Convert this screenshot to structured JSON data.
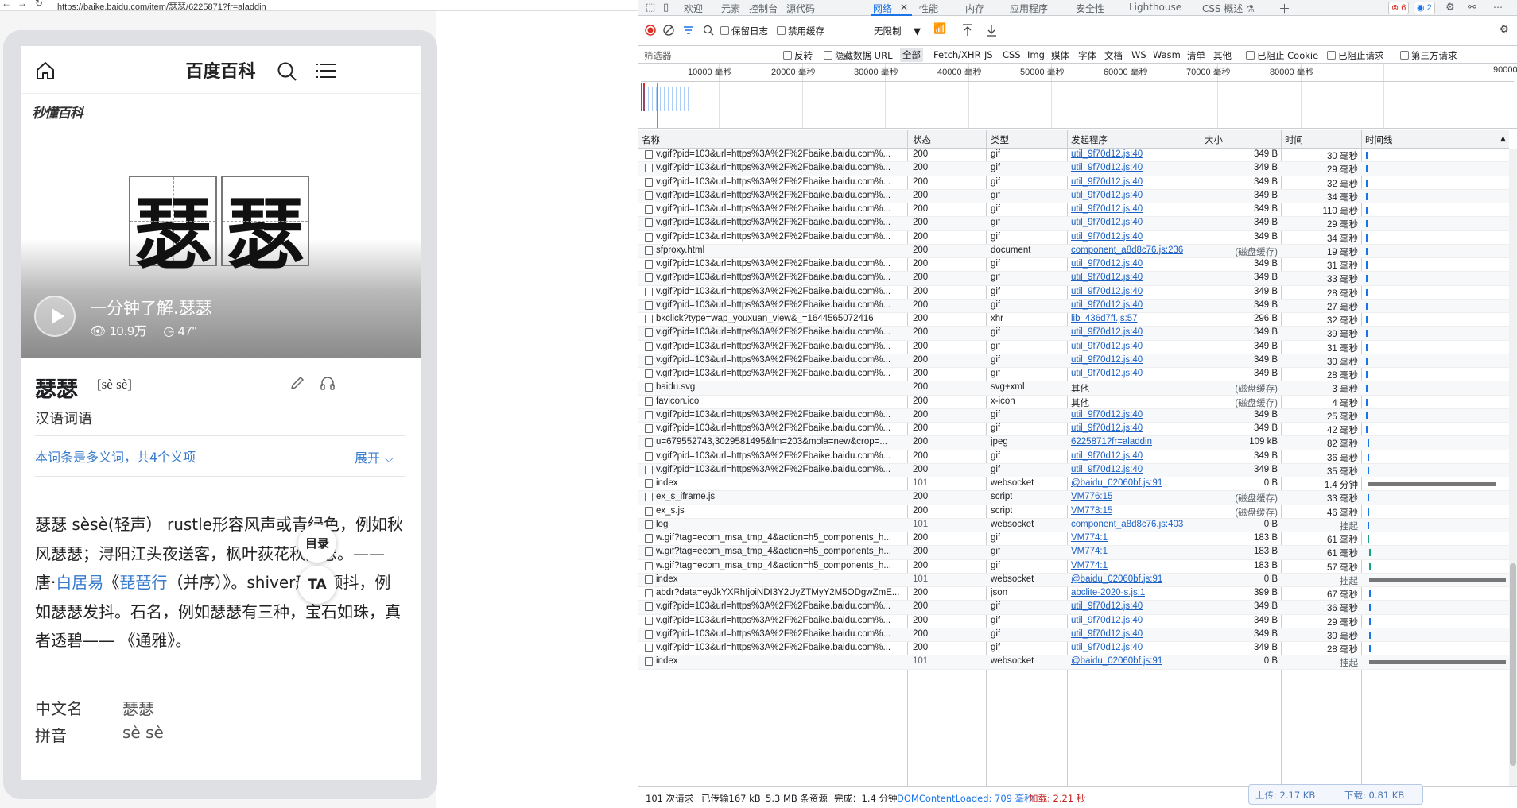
{
  "browser": {
    "url": "https://baike.baidu.com/item/瑟瑟/6225871?fr=aladdin"
  },
  "mobile": {
    "header_title": "百度百科",
    "logo_text": "秒懂百科",
    "characters": [
      "瑟",
      "瑟"
    ],
    "video_title": "一分钟了解.瑟瑟",
    "views": "10.9万",
    "duration": "47\"",
    "word": "瑟瑟",
    "pinyin": "[sè sè]",
    "entry_type": "汉语词语",
    "polysemy": "本词条是多义词，共4个义项",
    "expand": "展开",
    "desc_1": "瑟瑟 sèsè(轻声） rustle形容风声或青绿色，例如秋风瑟瑟；浔阳江头夜送客，枫叶荻花秋瑟瑟。—— 唐·",
    "desc_link1": "白居易",
    "desc_2": "《",
    "desc_link2": "琵琶行",
    "desc_3": "（并序）》。shiver形容颤抖，例如瑟瑟发抖。石名，例如瑟瑟有三种，宝石如珠，真者透碧—— 《通雅》。",
    "toc_button": "目录",
    "ta_button": "TA",
    "info_rows": [
      {
        "label": "中文名",
        "value": "瑟瑟"
      },
      {
        "label": "拼音",
        "value": "sè sè"
      }
    ]
  },
  "devtools": {
    "tabs": [
      "欢迎",
      "元素",
      "控制台",
      "源代码",
      "网络",
      "性能",
      "内存",
      "应用程序",
      "安全性",
      "Lighthouse",
      "CSS 概述 ⚗"
    ],
    "active_tab": "网络",
    "errors": "6",
    "messages": "2",
    "toolbar": {
      "preserve_log": "保留日志",
      "disable_cache": "禁用缓存",
      "throttle": "无限制"
    },
    "filter": {
      "placeholder": "筛选器",
      "invert": "反转",
      "hide_data_url": "隐藏数据 URL",
      "types": [
        "全部",
        "Fetch/XHR",
        "JS",
        "CSS",
        "Img",
        "媒体",
        "字体",
        "文档",
        "WS",
        "Wasm",
        "清单",
        "其他"
      ],
      "blocked_cookies": "已阻止 Cookie",
      "blocked_requests": "已阻止请求",
      "third_party": "第三方请求"
    },
    "overview_ticks": [
      "10000 毫秒",
      "20000 毫秒",
      "30000 毫秒",
      "40000 毫秒",
      "50000 毫秒",
      "60000 毫秒",
      "70000 毫秒",
      "80000 毫秒",
      "90000"
    ],
    "columns": [
      "名称",
      "状态",
      "类型",
      "发起程序",
      "大小",
      "时间",
      "时间线"
    ],
    "requests": [
      [
        "v.gif?pid=103&url=https%3A%2F%2Fbaike.baidu.com%...",
        "200",
        "gif",
        "util_9f70d12.js:40",
        "349 B",
        "30 毫秒"
      ],
      [
        "v.gif?pid=103&url=https%3A%2F%2Fbaike.baidu.com%...",
        "200",
        "gif",
        "util_9f70d12.js:40",
        "349 B",
        "29 毫秒"
      ],
      [
        "v.gif?pid=103&url=https%3A%2F%2Fbaike.baidu.com%...",
        "200",
        "gif",
        "util_9f70d12.js:40",
        "349 B",
        "32 毫秒"
      ],
      [
        "v.gif?pid=103&url=https%3A%2F%2Fbaike.baidu.com%...",
        "200",
        "gif",
        "util_9f70d12.js:40",
        "349 B",
        "34 毫秒"
      ],
      [
        "v.gif?pid=103&url=https%3A%2F%2Fbaike.baidu.com%...",
        "200",
        "gif",
        "util_9f70d12.js:40",
        "349 B",
        "110 毫秒"
      ],
      [
        "v.gif?pid=103&url=https%3A%2F%2Fbaike.baidu.com%...",
        "200",
        "gif",
        "util_9f70d12.js:40",
        "349 B",
        "29 毫秒"
      ],
      [
        "v.gif?pid=103&url=https%3A%2F%2Fbaike.baidu.com%...",
        "200",
        "gif",
        "util_9f70d12.js:40",
        "349 B",
        "34 毫秒"
      ],
      [
        "sfproxy.html",
        "200",
        "document",
        "component_a8d8c76.js:236",
        "(磁盘缓存)",
        "19 毫秒"
      ],
      [
        "v.gif?pid=103&url=https%3A%2F%2Fbaike.baidu.com%...",
        "200",
        "gif",
        "util_9f70d12.js:40",
        "349 B",
        "31 毫秒"
      ],
      [
        "v.gif?pid=103&url=https%3A%2F%2Fbaike.baidu.com%...",
        "200",
        "gif",
        "util_9f70d12.js:40",
        "349 B",
        "33 毫秒"
      ],
      [
        "v.gif?pid=103&url=https%3A%2F%2Fbaike.baidu.com%...",
        "200",
        "gif",
        "util_9f70d12.js:40",
        "349 B",
        "28 毫秒"
      ],
      [
        "v.gif?pid=103&url=https%3A%2F%2Fbaike.baidu.com%...",
        "200",
        "gif",
        "util_9f70d12.js:40",
        "349 B",
        "27 毫秒"
      ],
      [
        "bkclick?type=wap_youxuan_view&_=1644565072416",
        "200",
        "xhr",
        "lib_436d7ff.js:57",
        "296 B",
        "32 毫秒"
      ],
      [
        "v.gif?pid=103&url=https%3A%2F%2Fbaike.baidu.com%...",
        "200",
        "gif",
        "util_9f70d12.js:40",
        "349 B",
        "39 毫秒"
      ],
      [
        "v.gif?pid=103&url=https%3A%2F%2Fbaike.baidu.com%...",
        "200",
        "gif",
        "util_9f70d12.js:40",
        "349 B",
        "31 毫秒"
      ],
      [
        "v.gif?pid=103&url=https%3A%2F%2Fbaike.baidu.com%...",
        "200",
        "gif",
        "util_9f70d12.js:40",
        "349 B",
        "30 毫秒"
      ],
      [
        "v.gif?pid=103&url=https%3A%2F%2Fbaike.baidu.com%...",
        "200",
        "gif",
        "util_9f70d12.js:40",
        "349 B",
        "28 毫秒"
      ],
      [
        "baidu.svg",
        "200",
        "svg+xml",
        "其他",
        "(磁盘缓存)",
        "3 毫秒"
      ],
      [
        "favicon.ico",
        "200",
        "x-icon",
        "其他",
        "(磁盘缓存)",
        "4 毫秒"
      ],
      [
        "v.gif?pid=103&url=https%3A%2F%2Fbaike.baidu.com%...",
        "200",
        "gif",
        "util_9f70d12.js:40",
        "349 B",
        "25 毫秒"
      ],
      [
        "v.gif?pid=103&url=https%3A%2F%2Fbaike.baidu.com%...",
        "200",
        "gif",
        "util_9f70d12.js:40",
        "349 B",
        "42 毫秒"
      ],
      [
        "u=679552743,3029581495&fm=203&mola=new&crop=...",
        "200",
        "jpeg",
        "6225871?fr=aladdin",
        "109 kB",
        "82 毫秒"
      ],
      [
        "v.gif?pid=103&url=https%3A%2F%2Fbaike.baidu.com%...",
        "200",
        "gif",
        "util_9f70d12.js:40",
        "349 B",
        "36 毫秒"
      ],
      [
        "v.gif?pid=103&url=https%3A%2F%2Fbaike.baidu.com%...",
        "200",
        "gif",
        "util_9f70d12.js:40",
        "349 B",
        "35 毫秒"
      ],
      [
        "index",
        "101",
        "websocket",
        "@baidu_02060bf.js:91",
        "0 B",
        "1.4 分钟"
      ],
      [
        "ex_s_iframe.js",
        "200",
        "script",
        "VM776:15",
        "(磁盘缓存)",
        "33 毫秒"
      ],
      [
        "ex_s.js",
        "200",
        "script",
        "VM778:15",
        "(磁盘缓存)",
        "46 毫秒"
      ],
      [
        "log",
        "101",
        "websocket",
        "component_a8d8c76.js:403",
        "0 B",
        "挂起"
      ],
      [
        "w.gif?tag=ecom_msa_tmp_4&action=h5_components_h...",
        "200",
        "gif",
        "VM774:1",
        "183 B",
        "61 毫秒"
      ],
      [
        "w.gif?tag=ecom_msa_tmp_4&action=h5_components_h...",
        "200",
        "gif",
        "VM774:1",
        "183 B",
        "61 毫秒"
      ],
      [
        "w.gif?tag=ecom_msa_tmp_4&action=h5_components_h...",
        "200",
        "gif",
        "VM774:1",
        "183 B",
        "57 毫秒"
      ],
      [
        "index",
        "101",
        "websocket",
        "@baidu_02060bf.js:91",
        "0 B",
        "挂起"
      ],
      [
        "abdr?data=eyJkYXRhIjoiNDI3Y2UyZTMyY2M5ODgwZmE...",
        "200",
        "json",
        "abclite-2020-s.js:1",
        "399 B",
        "67 毫秒"
      ],
      [
        "v.gif?pid=103&url=https%3A%2F%2Fbaike.baidu.com%...",
        "200",
        "gif",
        "util_9f70d12.js:40",
        "349 B",
        "36 毫秒"
      ],
      [
        "v.gif?pid=103&url=https%3A%2F%2Fbaike.baidu.com%...",
        "200",
        "gif",
        "util_9f70d12.js:40",
        "349 B",
        "29 毫秒"
      ],
      [
        "v.gif?pid=103&url=https%3A%2F%2Fbaike.baidu.com%...",
        "200",
        "gif",
        "util_9f70d12.js:40",
        "349 B",
        "30 毫秒"
      ],
      [
        "v.gif?pid=103&url=https%3A%2F%2Fbaike.baidu.com%...",
        "200",
        "gif",
        "util_9f70d12.js:40",
        "349 B",
        "28 毫秒"
      ],
      [
        "index",
        "101",
        "websocket",
        "@baidu_02060bf.js:91",
        "0 B",
        "挂起"
      ]
    ],
    "status": {
      "requests": "101 次请求",
      "transferred": "已传输167 kB",
      "resources": "5.3 MB 条资源",
      "finish": "完成：1.4 分钟",
      "dcl": "DOMContentLoaded: 709 毫秒",
      "load": "加载: 2.21 秒"
    },
    "net_speed": {
      "up": "上传: 2.17 KB",
      "down": "下载: 0.81 KB"
    },
    "colors": {
      "accent": "#1a73e8",
      "link": "#1a5fc4",
      "error": "#d93025",
      "load": "#c5221f"
    }
  }
}
